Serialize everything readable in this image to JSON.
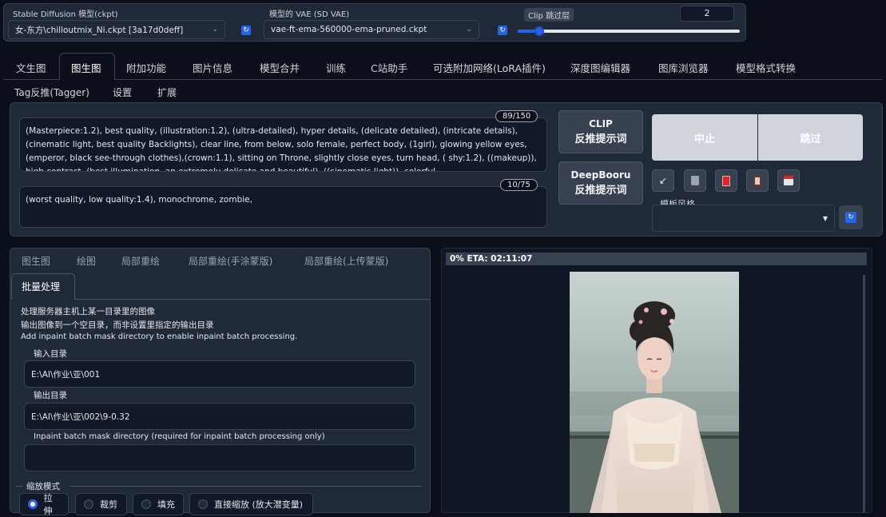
{
  "top": {
    "ckpt_label": "Stable Diffusion 模型(ckpt)",
    "ckpt_value": "女-东方\\chilloutmix_Ni.ckpt [3a17d0deff]",
    "vae_label": "模型的 VAE (SD VAE)",
    "vae_value": "vae-ft-ema-560000-ema-pruned.ckpt",
    "clip_label": "Clip 跳过层",
    "clip_value": "2",
    "clip_fraction": 0.08
  },
  "tabs": [
    "文生图",
    "图生图",
    "附加功能",
    "图片信息",
    "模型合并",
    "训练",
    "C站助手",
    "可选附加网络(LoRA插件)",
    "深度图编辑器",
    "图库浏览器",
    "模型格式转换",
    "Tag反推(Tagger)",
    "设置",
    "扩展"
  ],
  "prompt": {
    "text": "(Masterpiece:1.2), best quality, (illustration:1.2), (ultra-detailed), hyper details, (delicate detailed), (intricate details), (cinematic light, best quality Backlights), clear line, from below, solo female, perfect body, (1girl), glowing yellow eyes, (emperor, black see-through clothes),(crown:1.1), sitting on Throne, slightly close eyes, turn head, ( shy:1.2), ((makeup)), high contrast, (best illumination, an extremely delicate and beautiful), ((cinematic light)), colorful",
    "count": "89/150"
  },
  "negative": {
    "text": "(worst quality, low quality:1.4), monochrome, zombie,",
    "count": "10/75"
  },
  "buttons": {
    "clip_l1": "CLIP",
    "clip_l2": "反推提示词",
    "deep_l1": "DeepBooru",
    "deep_l2": "反推提示词",
    "interrupt": "中止",
    "skip": "跳过",
    "style_label": "模板风格"
  },
  "subtabs": [
    "图生图",
    "绘图",
    "局部重绘",
    "局部重绘(手涂蒙版)",
    "局部重绘(上传蒙版)",
    "批量处理"
  ],
  "batch": {
    "desc1": "处理服务器主机上某一目录里的图像",
    "desc2": "输出图像到一个空目录，而非设置里指定的输出目录",
    "desc3": "Add inpaint batch mask directory to enable inpaint batch processing.",
    "input_label": "输入目录",
    "input_value": "E:\\AI\\作业\\亚\\001",
    "output_label": "输出目录",
    "output_value": "E:\\AI\\作业\\亚\\002\\9-0.32",
    "mask_label": "Inpaint batch mask directory (required for inpaint batch processing only)",
    "mask_value": ""
  },
  "resize": {
    "label": "缩放模式",
    "options": [
      "拉伸",
      "裁剪",
      "填充",
      "直接缩放 (放大潜变量)"
    ],
    "selected": 0
  },
  "progress": {
    "text": "0% ETA: 02:11:07",
    "fraction": 0
  },
  "colors": {
    "accent": "#2563eb",
    "bg": "#0b0f19",
    "panel": "#1f2937"
  }
}
